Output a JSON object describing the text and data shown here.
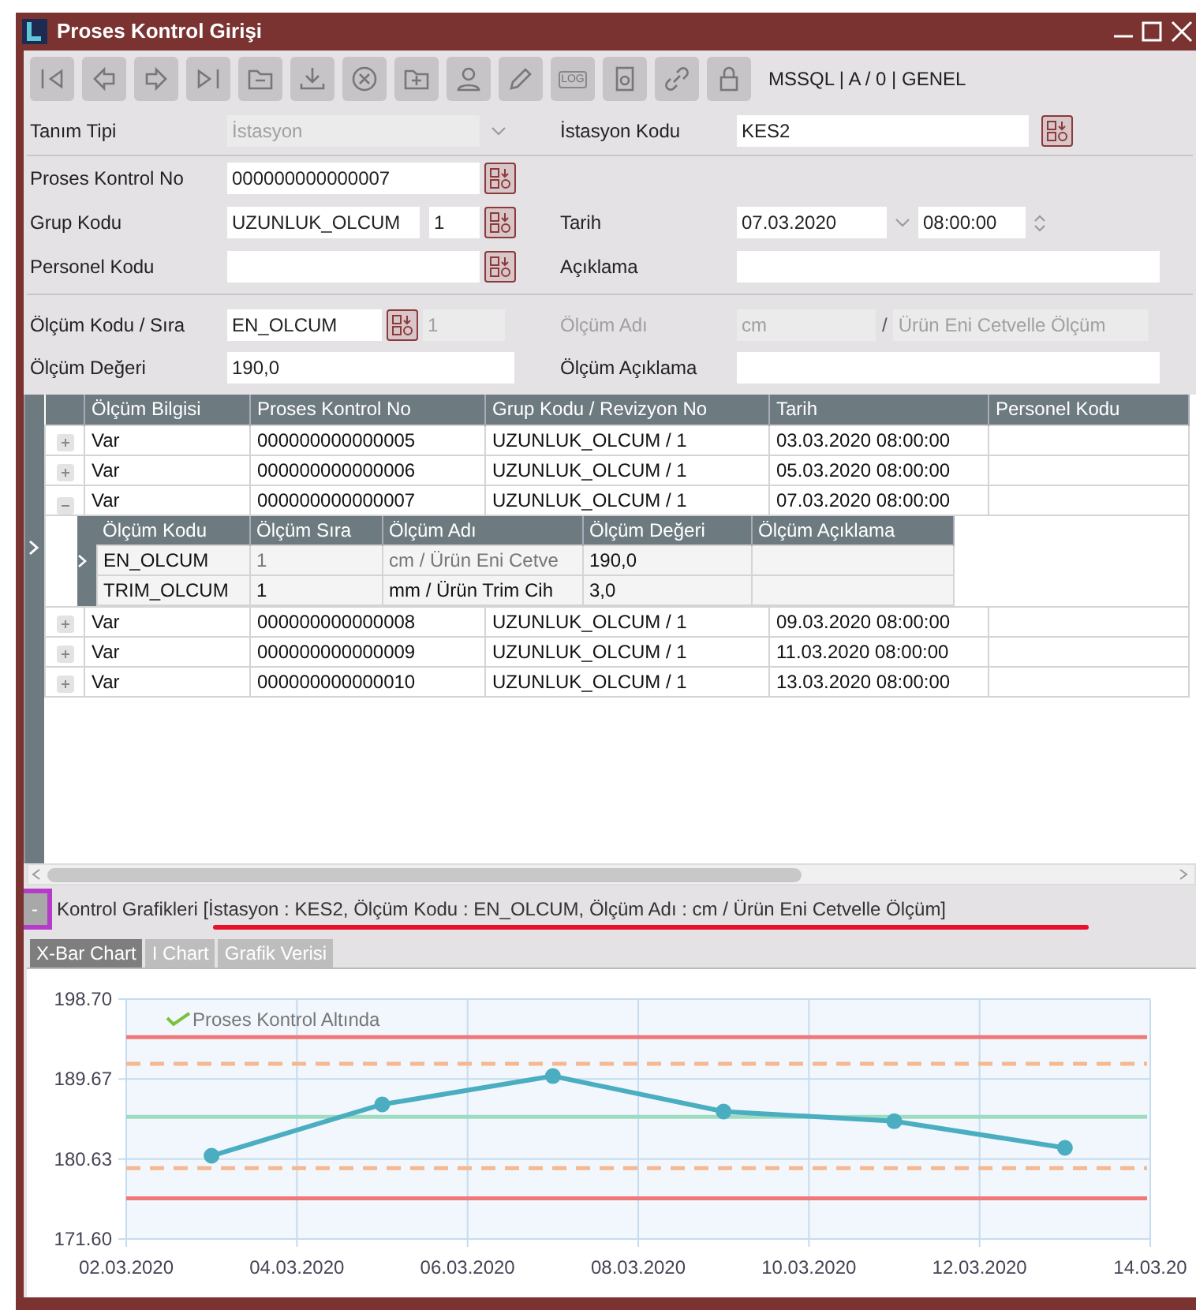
{
  "window": {
    "title": "Proses Kontrol Girişi"
  },
  "toolbar": {
    "log_label": "LOG",
    "connection": "MSSQL | A / 0 | GENEL"
  },
  "form": {
    "tanim_tipi": {
      "label": "Tanım Tipi",
      "value": "İstasyon",
      "disabled": true
    },
    "istasyon_kodu": {
      "label": "İstasyon Kodu",
      "value": "KES2"
    },
    "proses_kontrol_no": {
      "label": "Proses Kontrol No",
      "value": "000000000000007"
    },
    "grup_kodu": {
      "label": "Grup Kodu",
      "value": "UZUNLUK_OLCUM",
      "revision": "1"
    },
    "tarih": {
      "label": "Tarih",
      "date": "07.03.2020",
      "time": "08:00:00"
    },
    "personel_kodu": {
      "label": "Personel Kodu"
    },
    "aciklama": {
      "label": "Açıklama"
    },
    "olcum_kodu": {
      "label": "Ölçüm Kodu / Sıra",
      "value": "EN_OLCUM",
      "sequence": "1",
      "sequence_disabled": true
    },
    "olcum_adi": {
      "label": "Ölçüm Adı",
      "disabled": true,
      "unit": "cm",
      "separator": "/",
      "name": "Ürün Eni Cetvelle Ölçüm"
    },
    "olcum_degeri": {
      "label": "Ölçüm Değeri",
      "value": "190,0"
    },
    "olcum_aciklama": {
      "label": "Ölçüm Açıklama"
    }
  },
  "grid": {
    "columns": [
      "Ölçüm Bilgisi",
      "Proses Kontrol No",
      "Grup Kodu / Revizyon No",
      "Tarih",
      "Personel Kodu"
    ],
    "rows": [
      {
        "expanded": false,
        "cells": [
          "Var",
          "000000000000005",
          "UZUNLUK_OLCUM / 1",
          "03.03.2020 08:00:00"
        ]
      },
      {
        "expanded": false,
        "cells": [
          "Var",
          "000000000000006",
          "UZUNLUK_OLCUM / 1",
          "05.03.2020 08:00:00"
        ]
      },
      {
        "expanded": true,
        "cells": [
          "Var",
          "000000000000007",
          "UZUNLUK_OLCUM / 1",
          "07.03.2020 08:00:00"
        ],
        "detail": {
          "columns": [
            "Ölçüm Kodu",
            "Ölçüm Sıra",
            "Ölçüm Adı",
            "Ölçüm Değeri",
            "Ölçüm Açıklama"
          ],
          "rows": [
            {
              "selected": true,
              "cells": [
                "EN_OLCUM",
                "1",
                "cm / Ürün Eni Cetve",
                "190,0"
              ]
            },
            {
              "selected": false,
              "cells": [
                "TRIM_OLCUM",
                "1",
                "mm / Ürün Trim Cih",
                "3,0"
              ]
            }
          ]
        }
      },
      {
        "expanded": false,
        "cells": [
          "Var",
          "000000000000008",
          "UZUNLUK_OLCUM / 1",
          "09.03.2020 08:00:00"
        ]
      },
      {
        "expanded": false,
        "cells": [
          "Var",
          "000000000000009",
          "UZUNLUK_OLCUM / 1",
          "11.03.2020 08:00:00"
        ]
      },
      {
        "expanded": false,
        "cells": [
          "Var",
          "000000000000010",
          "UZUNLUK_OLCUM / 1",
          "13.03.2020 08:00:00"
        ]
      }
    ]
  },
  "chart_section": {
    "collapse_label": "-",
    "title": "Kontrol Grafikleri [İstasyon : KES2, Ölçüm Kodu : EN_OLCUM, Ölçüm Adı : cm / Ürün Eni Cetvelle Ölçüm]",
    "tabs": [
      {
        "label": "X-Bar Chart",
        "selected": true
      },
      {
        "label": "I Chart",
        "selected": false
      },
      {
        "label": "Grafik Verisi",
        "selected": false
      }
    ],
    "chart_data": {
      "type": "line",
      "categories": [
        "02.03.2020",
        null,
        "04.03.2020",
        null,
        "06.03.2020",
        null,
        "08.03.2020",
        null,
        "10.03.2020",
        null,
        "12.03.2020",
        null,
        "14.03.20"
      ],
      "series": [
        {
          "color": "#4aaec0",
          "marker": true,
          "values": [
            null,
            181.0,
            null,
            186.8,
            null,
            190.0,
            null,
            186.0,
            null,
            184.9,
            null,
            181.9,
            null
          ]
        }
      ],
      "grid": true,
      "ylim": [
        171.6,
        198.7
      ],
      "yticks": [
        {
          "value": 198.7,
          "label": "198.70"
        },
        {
          "value": 189.67,
          "label": "189.67"
        },
        {
          "value": 180.63,
          "label": "180.63"
        },
        {
          "value": 171.6,
          "label": "171.60"
        }
      ],
      "ref_lines": [
        {
          "axis": "y",
          "value": 194.4,
          "color": "#f07878"
        },
        {
          "axis": "y",
          "value": 191.4,
          "color": "#f5b890"
        },
        {
          "axis": "y",
          "value": 185.4,
          "color": "#9edcc0"
        },
        {
          "axis": "y",
          "value": 179.6,
          "color": "#f5b890"
        },
        {
          "axis": "y",
          "value": 176.2,
          "color": "#f07878"
        }
      ],
      "annotations": [
        "Proses Kontrol Altında"
      ]
    }
  }
}
